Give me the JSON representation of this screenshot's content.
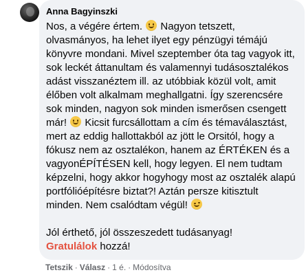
{
  "comment": {
    "author": "Anna Bagyinszki",
    "avatar_icon": "profile-photo",
    "paragraph1": {
      "seg1": "Nos, a végére értem.",
      "seg2": "Nagyon tetszett, olvasmányos, ha lehet ilyet egy pénzügyi témájú könyvre mondani. Mivel szeptember óta tag vagyok itt, sok leckét áttanultam és valamennyi tudásosztalékos adást visszanéztem ill. az utóbbiak közül volt, amit élőben volt alkalmam meghallgatni. Így szerencsére sok minden, nagyon sok minden ismerősen csengett már!",
      "seg3": "Kicsit furcsállottam a cím és témaválasztást, mert az eddig hallottakból az jött le Orsitól, hogy a fókusz nem az osztalékon, hanem az ÉRTÉKEN és a vagyonÉPÍTÉSEN kell, hogy legyen. El nem tudtam képzelni, hogy akkor hogyhogy most az osztalék alapú portfólióépítésre biztat?! Aztán persze kitisztult minden. Nem csalódtam végül!",
      "emoji1": "slightly-smiling-face-icon",
      "emoji2": "slightly-smiling-face-icon",
      "emoji3": "winking-face-icon"
    },
    "paragraph2": {
      "text": "Jól érthető, jól összeszedett tudásanyag!",
      "tag": "Gratulálok",
      "after_tag": " hozzá!"
    },
    "tag_color": "#e4513f"
  },
  "actions": {
    "like": "Tetszik",
    "reply": "Válasz",
    "separator": "·",
    "time": "1 é.",
    "edited": "Módosítva"
  }
}
